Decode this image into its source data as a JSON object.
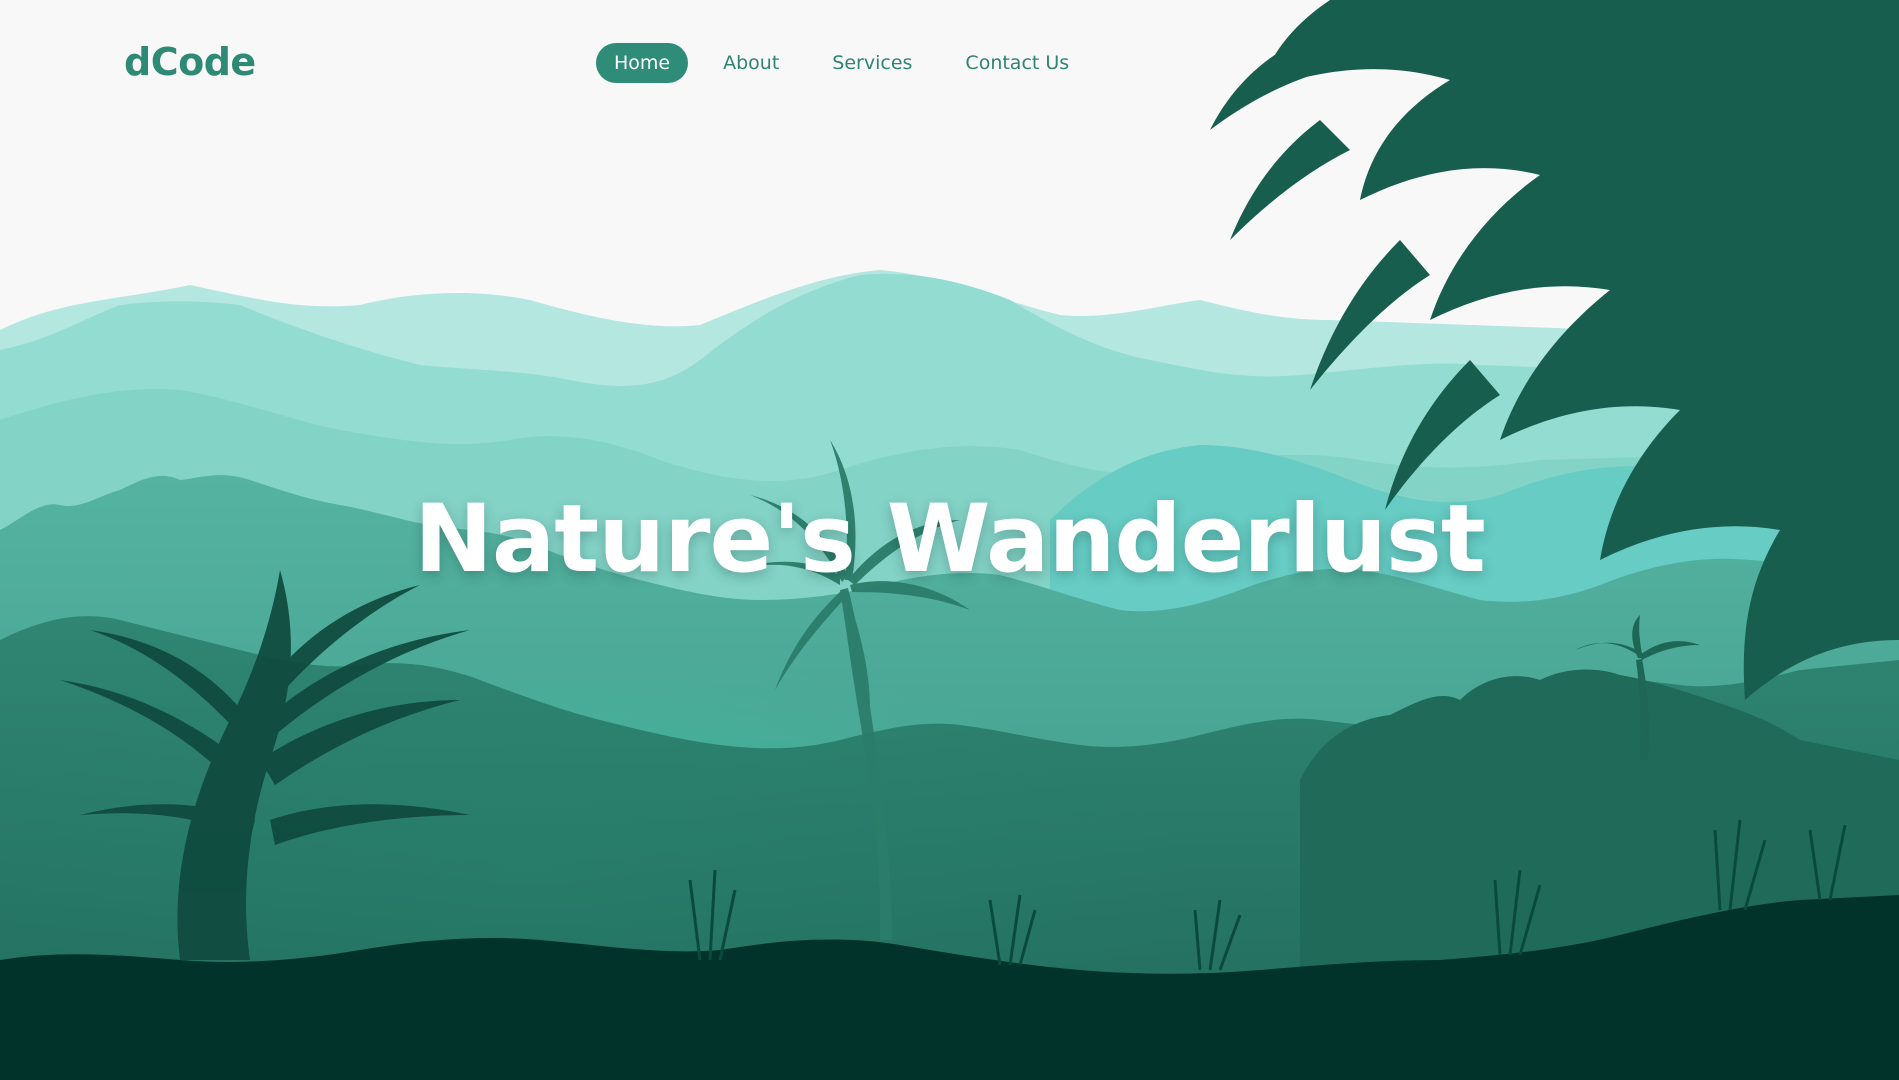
{
  "brand": {
    "logo_text": "dCode"
  },
  "nav": {
    "items": [
      {
        "label": "Home",
        "active": true
      },
      {
        "label": "About",
        "active": false
      },
      {
        "label": "Services",
        "active": false
      },
      {
        "label": "Contact Us",
        "active": false
      }
    ]
  },
  "hero": {
    "title": "Nature's Wanderlust"
  },
  "colors": {
    "accent": "#2e8c78",
    "background": "#f8f8f8",
    "ground": "#02332a",
    "title_text": "#ffffff"
  }
}
